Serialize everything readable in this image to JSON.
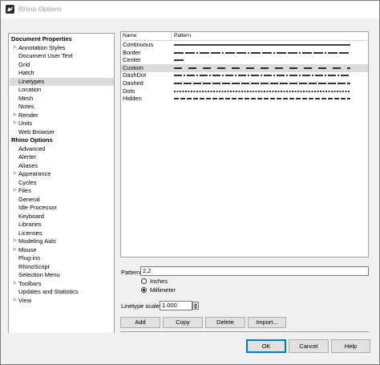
{
  "window": {
    "title": "Rhino Options"
  },
  "tree": {
    "items": [
      {
        "label": "Document Properties",
        "header": true,
        "expander": "",
        "selected": false
      },
      {
        "label": "Annotation Styles",
        "header": false,
        "expander": ">",
        "selected": false
      },
      {
        "label": "Document User Text",
        "header": false,
        "expander": "",
        "selected": false
      },
      {
        "label": "Grid",
        "header": false,
        "expander": "",
        "selected": false
      },
      {
        "label": "Hatch",
        "header": false,
        "expander": "",
        "selected": false
      },
      {
        "label": "Linetypes",
        "header": false,
        "expander": "",
        "selected": true
      },
      {
        "label": "Location",
        "header": false,
        "expander": "",
        "selected": false
      },
      {
        "label": "Mesh",
        "header": false,
        "expander": "",
        "selected": false
      },
      {
        "label": "Notes",
        "header": false,
        "expander": "",
        "selected": false
      },
      {
        "label": "Render",
        "header": false,
        "expander": ">",
        "selected": false
      },
      {
        "label": "Units",
        "header": false,
        "expander": ">",
        "selected": false
      },
      {
        "label": "Web Browser",
        "header": false,
        "expander": "",
        "selected": false
      },
      {
        "label": "Rhino Options",
        "header": true,
        "expander": "",
        "selected": false
      },
      {
        "label": "Advanced",
        "header": false,
        "expander": "",
        "selected": false
      },
      {
        "label": "Alerter",
        "header": false,
        "expander": "",
        "selected": false
      },
      {
        "label": "Aliases",
        "header": false,
        "expander": "",
        "selected": false
      },
      {
        "label": "Appearance",
        "header": false,
        "expander": ">",
        "selected": false
      },
      {
        "label": "Cycles",
        "header": false,
        "expander": "",
        "selected": false
      },
      {
        "label": "Files",
        "header": false,
        "expander": ">",
        "selected": false
      },
      {
        "label": "General",
        "header": false,
        "expander": "",
        "selected": false
      },
      {
        "label": "Idle Processor",
        "header": false,
        "expander": "",
        "selected": false
      },
      {
        "label": "Keyboard",
        "header": false,
        "expander": "",
        "selected": false
      },
      {
        "label": "Libraries",
        "header": false,
        "expander": "",
        "selected": false
      },
      {
        "label": "Licenses",
        "header": false,
        "expander": "",
        "selected": false
      },
      {
        "label": "Modeling Aids",
        "header": false,
        "expander": ">",
        "selected": false
      },
      {
        "label": "Mouse",
        "header": false,
        "expander": ">",
        "selected": false
      },
      {
        "label": "Plug-ins",
        "header": false,
        "expander": "",
        "selected": false
      },
      {
        "label": "RhinoScript",
        "header": false,
        "expander": "",
        "selected": false
      },
      {
        "label": "Selection Menu",
        "header": false,
        "expander": "",
        "selected": false
      },
      {
        "label": "Toolbars",
        "header": false,
        "expander": ">",
        "selected": false
      },
      {
        "label": "Updates and Statistics",
        "header": false,
        "expander": "",
        "selected": false
      },
      {
        "label": "View",
        "header": false,
        "expander": ">",
        "selected": false
      }
    ]
  },
  "linetypes": {
    "columns": {
      "name": "Name",
      "pattern": "Pattern"
    },
    "rows": [
      {
        "name": "Continuous",
        "pattern": "continuous",
        "selected": false
      },
      {
        "name": "Border",
        "pattern": "border",
        "selected": false
      },
      {
        "name": "Center",
        "pattern": "center",
        "selected": false
      },
      {
        "name": "Custom",
        "pattern": "custom",
        "selected": true
      },
      {
        "name": "DashDot",
        "pattern": "dashdot",
        "selected": false
      },
      {
        "name": "Dashed",
        "pattern": "dashed",
        "selected": false
      },
      {
        "name": "Dots",
        "pattern": "dots",
        "selected": false
      },
      {
        "name": "Hidden",
        "pattern": "hidden",
        "selected": false
      }
    ]
  },
  "pattern": {
    "label": "Pattern",
    "value": "2,2"
  },
  "units": {
    "inches_label": "Inches",
    "millimeter_label": "Millimeter",
    "selected": "Millimeter"
  },
  "scale": {
    "label": "Linetype scale:",
    "value": "1.000"
  },
  "actions": {
    "add": "Add",
    "copy": "Copy",
    "delete": "Delete",
    "import": "Import..."
  },
  "dialog": {
    "ok": "OK",
    "cancel": "Cancel",
    "help": "Help"
  },
  "colors": {
    "selection": "#dcdcdc",
    "default_button_border": "#0078d7"
  }
}
